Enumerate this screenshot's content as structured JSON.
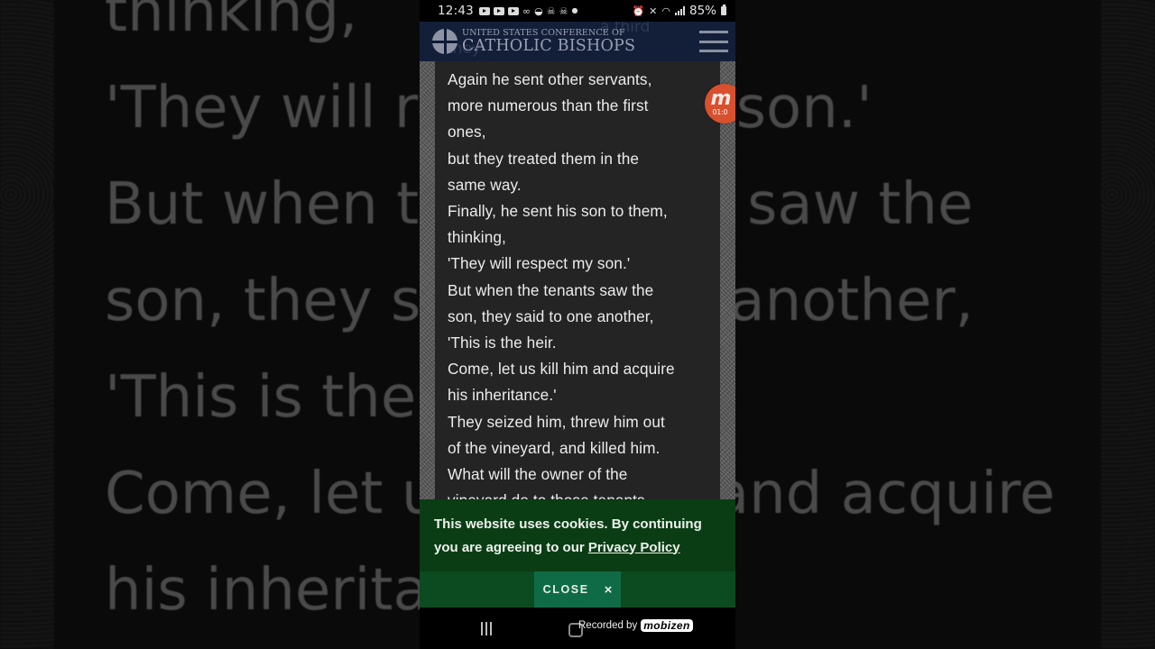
{
  "background_overlay": {
    "lines": [
      "thinking,",
      "'They will respect my son.'",
      "But when the tenants saw the",
      "son, they said to one another,",
      "'This is the heir.",
      "Come, let us kill him and acquire",
      "his inheritance.'"
    ]
  },
  "status_bar": {
    "time": "12:43",
    "left_icons": [
      "youtube-icon",
      "youtube-icon",
      "youtube-icon",
      "voicemail-icon",
      "bowl-icon",
      "skull-icon",
      "skull-icon",
      "dot-icon"
    ],
    "right_icons": [
      "alarm-icon",
      "mute-icon",
      "wifi-icon",
      "signal-icon",
      "battery-icon"
    ],
    "battery": "85%"
  },
  "header": {
    "org_line1": "UNITED STATES CONFERENCE OF",
    "org_line2": "CATHOLIC BISHOPS",
    "ghost_line1": "a third",
    "ghost_line2": "they",
    "menu_icon": "hamburger-menu-icon"
  },
  "scripture": {
    "lines": [
      "Again he sent other servants,",
      "more numerous than the first",
      "ones,",
      "but they treated them in the",
      "same way.",
      "Finally, he sent his son to them,",
      "thinking,",
      "'They will respect my son.'",
      "But when the tenants saw the",
      "son, they said to one another,",
      "'This is the heir.",
      "Come, let us kill him and acquire",
      "his inheritance.'",
      "They seized him, threw him out",
      "of the vineyard, and killed him.",
      "What will the owner of the",
      "vineyard do to those tenants"
    ]
  },
  "recorder": {
    "logo_letter": "m",
    "timer": "01:0"
  },
  "cookie_banner": {
    "text_prefix": "This website uses cookies. By continuing you are agreeing to our ",
    "link_text": "Privacy Policy",
    "text_suffix": "",
    "close_label": "CLOSE",
    "close_icon": "×",
    "colors": {
      "banner": "#0a3d14",
      "button": "#0f6b46"
    }
  },
  "nav_bar": {
    "recorded_by": "Recorded by",
    "brand": "mobizen"
  }
}
